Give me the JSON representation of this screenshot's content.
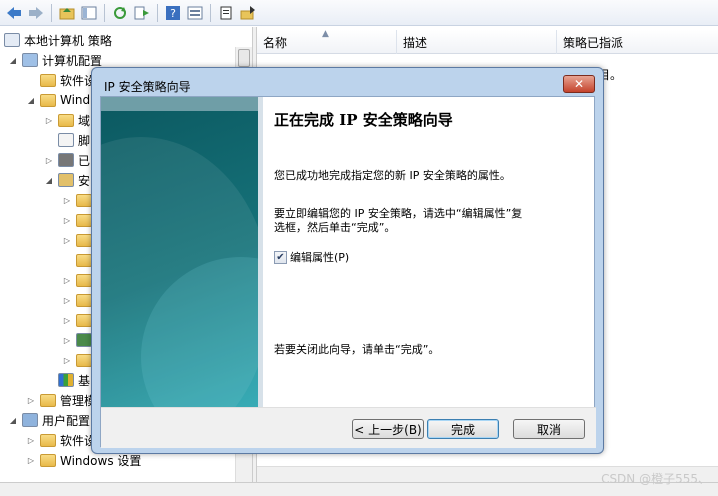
{
  "toolbar": {
    "buttons": [
      "back-icon",
      "forward-icon",
      "up-folder-icon",
      "show-hide-tree-icon",
      "refresh-icon",
      "export-list-icon",
      "help-icon",
      "properties-icon",
      "new-policy-icon",
      "policy-action-icon"
    ]
  },
  "tree": {
    "items": [
      {
        "label": "本地计算机 策略",
        "icon": "policy-icon",
        "expanded": true
      },
      {
        "label": "计算机配置",
        "icon": "computer-icon",
        "expanded": true
      },
      {
        "label": "软件设",
        "icon": "folder-icon",
        "expanded": false
      },
      {
        "label": "Wind",
        "icon": "folder-icon",
        "expanded": true
      },
      {
        "label": "域",
        "icon": "folder-icon",
        "expanded": false
      },
      {
        "label": "脚",
        "icon": "script-icon",
        "expanded": false
      },
      {
        "label": "已",
        "icon": "printer-icon",
        "expanded": false
      },
      {
        "label": "安",
        "icon": "security-icon",
        "expanded": true
      },
      {
        "label": "",
        "icon": "folder-icon",
        "expanded": false
      },
      {
        "label": "",
        "icon": "folder-icon",
        "expanded": false
      },
      {
        "label": "",
        "icon": "folder-icon",
        "expanded": false
      },
      {
        "label": "",
        "icon": "folder-icon",
        "expanded": false
      },
      {
        "label": "",
        "icon": "folder-icon",
        "expanded": false
      },
      {
        "label": "",
        "icon": "folder-icon",
        "expanded": false
      },
      {
        "label": "",
        "icon": "folder-icon",
        "expanded": false
      },
      {
        "label": "",
        "icon": "ip-security-icon",
        "expanded": false
      },
      {
        "label": "",
        "icon": "folder-icon",
        "expanded": false
      },
      {
        "label": "基",
        "icon": "chart-icon",
        "expanded": false
      },
      {
        "label": "管理模",
        "icon": "folder-icon",
        "expanded": false
      },
      {
        "label": "用户配置",
        "icon": "user-icon",
        "expanded": true
      },
      {
        "label": "软件设",
        "icon": "folder-icon",
        "expanded": false
      },
      {
        "label": "Windows 设置",
        "icon": "folder-icon",
        "expanded": false
      }
    ]
  },
  "list": {
    "columns": [
      "名称",
      "描述",
      "策略已指派"
    ],
    "partial_text": "目。"
  },
  "dialog": {
    "title": "IP 安全策略向导",
    "close_label": "✕",
    "heading": "正在完成 IP 安全策略向导",
    "paragraph1": "您已成功地完成指定您的新 IP 安全策略的属性。",
    "paragraph2_line1": "要立即编辑您的 IP 安全策略，请选中“编辑属性”复",
    "paragraph2_line2": "选框，然后单击“完成”。",
    "checkbox_label": "编辑属性(P)",
    "checkbox_checked": true,
    "close_hint": "若要关闭此向导，请单击“完成”。",
    "back_button": "< 上一步(B)",
    "finish_button": "完成",
    "cancel_button": "取消"
  },
  "watermark": "CSDN @橙子555、"
}
